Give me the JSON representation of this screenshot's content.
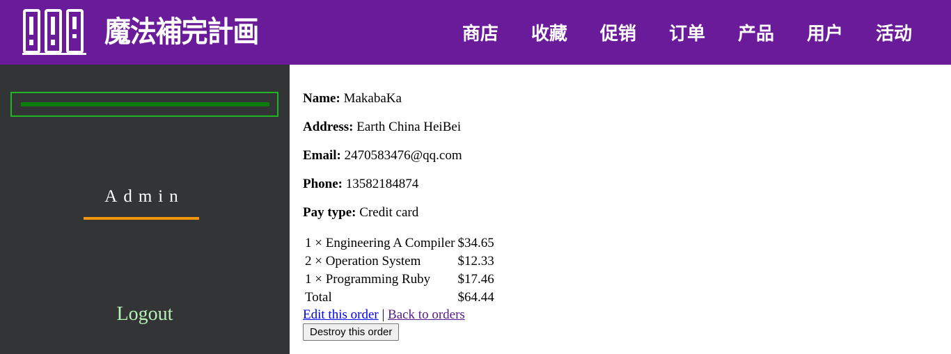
{
  "header": {
    "site_title": "魔法補完計画",
    "logo_icon": "books-logo-icon",
    "nav": [
      {
        "label": "商店"
      },
      {
        "label": "收藏"
      },
      {
        "label": "促销"
      },
      {
        "label": "订单"
      },
      {
        "label": "产品"
      },
      {
        "label": "用户"
      },
      {
        "label": "活动"
      }
    ]
  },
  "sidebar": {
    "progress_fraction": 1.0,
    "admin_label": "Admin",
    "logout_label": "Logout"
  },
  "order": {
    "name_label": "Name:",
    "name": "MakabaKa",
    "address_label": "Address:",
    "address": "Earth China HeiBei",
    "email_label": "Email:",
    "email": "2470583476@qq.com",
    "phone_label": "Phone:",
    "phone": "13582184874",
    "pay_type_label": "Pay type:",
    "pay_type": "Credit card",
    "line_items": [
      {
        "qty_title": "1 × Engineering A Compiler",
        "price": "$34.65"
      },
      {
        "qty_title": "2 × Operation System",
        "price": "$12.33"
      },
      {
        "qty_title": "1 × Programming Ruby",
        "price": "$17.46"
      }
    ],
    "total_label": "Total",
    "total": "$64.44",
    "edit_link": "Edit this order",
    "separator": "|",
    "back_link": "Back to orders",
    "destroy_button": "Destroy this order"
  },
  "colors": {
    "banner": "#6a1b9a",
    "sidebar": "#323436",
    "progress_border": "#22b422",
    "progress_fill": "#0a7d0a",
    "admin_underline": "#f0960a",
    "logout": "#b8f0b8"
  }
}
